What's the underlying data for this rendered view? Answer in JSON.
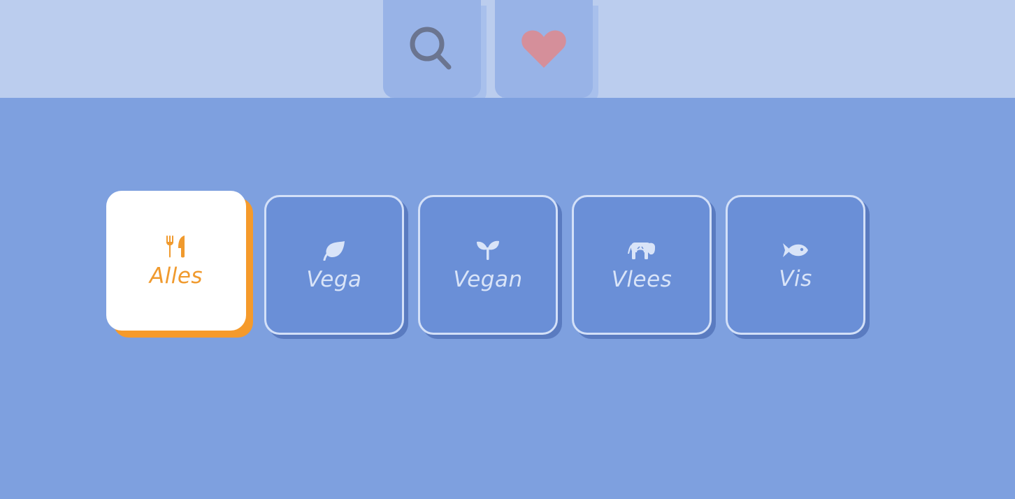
{
  "header": {
    "tabs": [
      {
        "icon": "search-icon"
      },
      {
        "icon": "heart-icon"
      }
    ]
  },
  "filters": {
    "selected": "Alles",
    "items": [
      {
        "label": "Alles",
        "icon": "utensils-icon",
        "active": true
      },
      {
        "label": "Vega",
        "icon": "leaf-icon",
        "active": false
      },
      {
        "label": "Vegan",
        "icon": "seedling-icon",
        "active": false
      },
      {
        "label": "Vlees",
        "icon": "cow-icon",
        "active": false
      },
      {
        "label": "Vis",
        "icon": "fish-icon",
        "active": false
      }
    ]
  },
  "colors": {
    "topbar": "#bbcdee",
    "tab": "#98b3e7",
    "background": "#7ea0df",
    "accent": "#f59a2b",
    "heart": "#d58f9a",
    "search_icon": "#6b7590",
    "inactive_card": "#6a8fd7",
    "inactive_text": "#d9e4f8"
  }
}
